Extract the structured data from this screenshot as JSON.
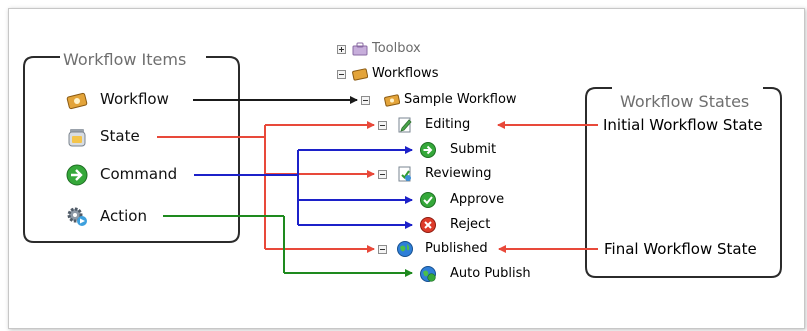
{
  "left_box": {
    "title": "Workflow Items",
    "items": [
      {
        "label": "Workflow",
        "icon": "workflow-icon"
      },
      {
        "label": "State",
        "icon": "state-jar-icon"
      },
      {
        "label": "Command",
        "icon": "command-arrow-icon"
      },
      {
        "label": "Action",
        "icon": "action-gear-icon"
      }
    ]
  },
  "tree": {
    "root_items": [
      {
        "label": "Toolbox",
        "icon": "toolbox-icon",
        "expanded": false
      },
      {
        "label": "Workflows",
        "icon": "workflows-folder-icon",
        "expanded": true
      }
    ],
    "workflow": {
      "label": "Sample Workflow",
      "icon": "workflow-icon"
    },
    "nodes": [
      {
        "label": "Editing",
        "icon": "state-edit-icon",
        "type": "state"
      },
      {
        "label": "Submit",
        "icon": "command-arrow-icon",
        "type": "command"
      },
      {
        "label": "Reviewing",
        "icon": "state-review-icon",
        "type": "state"
      },
      {
        "label": "Approve",
        "icon": "approve-check-icon",
        "type": "command"
      },
      {
        "label": "Reject",
        "icon": "reject-x-icon",
        "type": "command"
      },
      {
        "label": "Published",
        "icon": "globe-icon",
        "type": "state"
      },
      {
        "label": "Auto Publish",
        "icon": "auto-publish-icon",
        "type": "action"
      }
    ]
  },
  "right_box": {
    "title": "Workflow States",
    "initial_label": "Initial Workflow State",
    "final_label": "Final Workflow State"
  },
  "connector_colors": {
    "workflow": "#1a1a1a",
    "state": "#e8493a",
    "command": "#1c21c9",
    "action": "#1e8a1e"
  }
}
